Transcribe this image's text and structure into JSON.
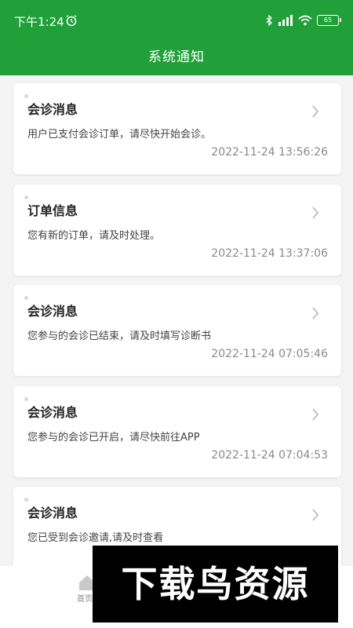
{
  "status": {
    "time": "下午1:24",
    "battery": "65"
  },
  "header": {
    "title": "系统通知"
  },
  "notifications": [
    {
      "title": "会诊消息",
      "message": "用户已支付会诊订单，请尽快开始会诊。",
      "time": "2022-11-24 13:56:26"
    },
    {
      "title": "订单信息",
      "message": "您有新的订单，请及时处理。",
      "time": "2022-11-24 13:37:06"
    },
    {
      "title": "会诊消息",
      "message": "您参与的会诊已结束，请及时填写诊断书",
      "time": "2022-11-24 07:05:46"
    },
    {
      "title": "会诊消息",
      "message": "您参与的会诊已开启，请尽快前往APP",
      "time": "2022-11-24 07:04:53"
    },
    {
      "title": "会诊消息",
      "message": "您已受到会诊邀请,请及时查看",
      "time": ""
    }
  ],
  "bottom_nav": {
    "home_label": "首页"
  },
  "watermark": {
    "text": "下载鸟资源"
  },
  "colors": {
    "header_green": "#21a03a",
    "background": "#f4f4f4"
  }
}
